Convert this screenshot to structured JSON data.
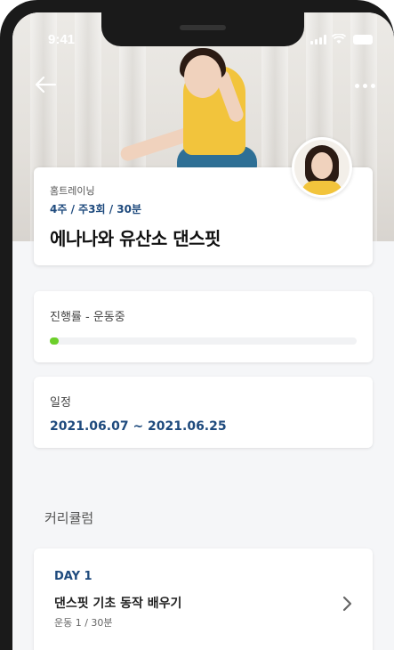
{
  "status_bar": {
    "time": "9:41",
    "signal_icon": "signal-icon",
    "wifi_icon": "wifi-icon",
    "battery_icon": "battery-icon"
  },
  "header": {
    "back_icon": "arrow-left-icon",
    "more_icon": "more-horizontal-icon"
  },
  "program": {
    "category": "홈트레이닝",
    "schedule_summary": "4주 / 주3회 / 30분",
    "title": "에나나와 유산소 댄스핏"
  },
  "progress": {
    "label": "진행률 - 운동중",
    "value_percent": 2,
    "color": "#6ccf2a"
  },
  "schedule": {
    "label": "일정",
    "range": "2021.06.07 ~ 2021.06.25"
  },
  "curriculum": {
    "section_title": "커리큘럼",
    "days": [
      {
        "day": "DAY 1",
        "title": "댄스핏 기초 동작 배우기",
        "meta": "운동 1 / 30분",
        "chevron_icon": "chevron-right-icon"
      }
    ]
  },
  "colors": {
    "accent": "#1e4a7d",
    "progress": "#6ccf2a",
    "background": "#f5f6f8"
  }
}
